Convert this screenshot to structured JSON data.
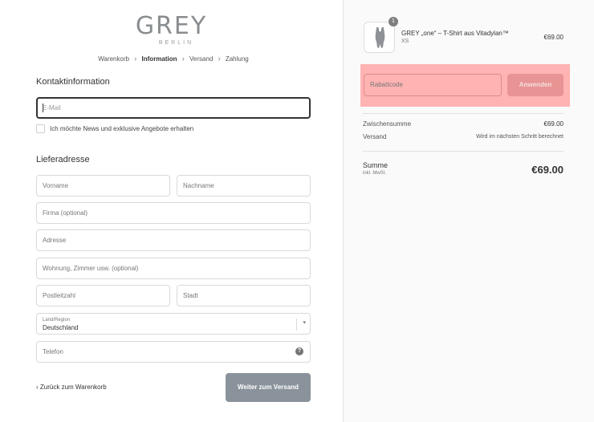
{
  "brand": {
    "name": "GREY",
    "subname": "BERLIN"
  },
  "breadcrumb": [
    {
      "label": "Warenkorb",
      "active": false
    },
    {
      "label": "Information",
      "active": true
    },
    {
      "label": "Versand",
      "active": false
    },
    {
      "label": "Zahlung",
      "active": false
    }
  ],
  "contact": {
    "title": "Kontaktinformation",
    "email_placeholder": "E-Mail",
    "newsletter_label": "Ich möchte News und exklusive Angebote erhalten"
  },
  "shipping": {
    "title": "Lieferadresse",
    "first_name_placeholder": "Vorname",
    "last_name_placeholder": "Nachname",
    "company_placeholder": "Firma (optional)",
    "address_placeholder": "Adresse",
    "apartment_placeholder": "Wohnung, Zimmer usw. (optional)",
    "postal_placeholder": "Postleitzahl",
    "city_placeholder": "Stadt",
    "country_label": "Land/Region",
    "country_value": "Deutschland",
    "phone_placeholder": "Telefon"
  },
  "actions": {
    "back_label": "Zurück zum Warenkorb",
    "continue_label": "Weiter zum Versand"
  },
  "cart": {
    "item": {
      "quantity": "1",
      "name": "GREY „one“ – T-Shirt aus Vitadylan™",
      "variant": "XS",
      "price": "€69.00"
    },
    "discount_placeholder": "Rabattcode",
    "apply_label": "Anwenden",
    "subtotal_label": "Zwischensumme",
    "subtotal_value": "€69.00",
    "shipping_label": "Versand",
    "shipping_value": "Wird im nächsten Schritt berechnet",
    "total_label": "Summe",
    "total_sub": "inkl. MwSt.",
    "total_value": "€69.00"
  },
  "colors": {
    "button": "#8a939b",
    "highlight": "#ffb3b3",
    "apply_button": "#e89494"
  }
}
